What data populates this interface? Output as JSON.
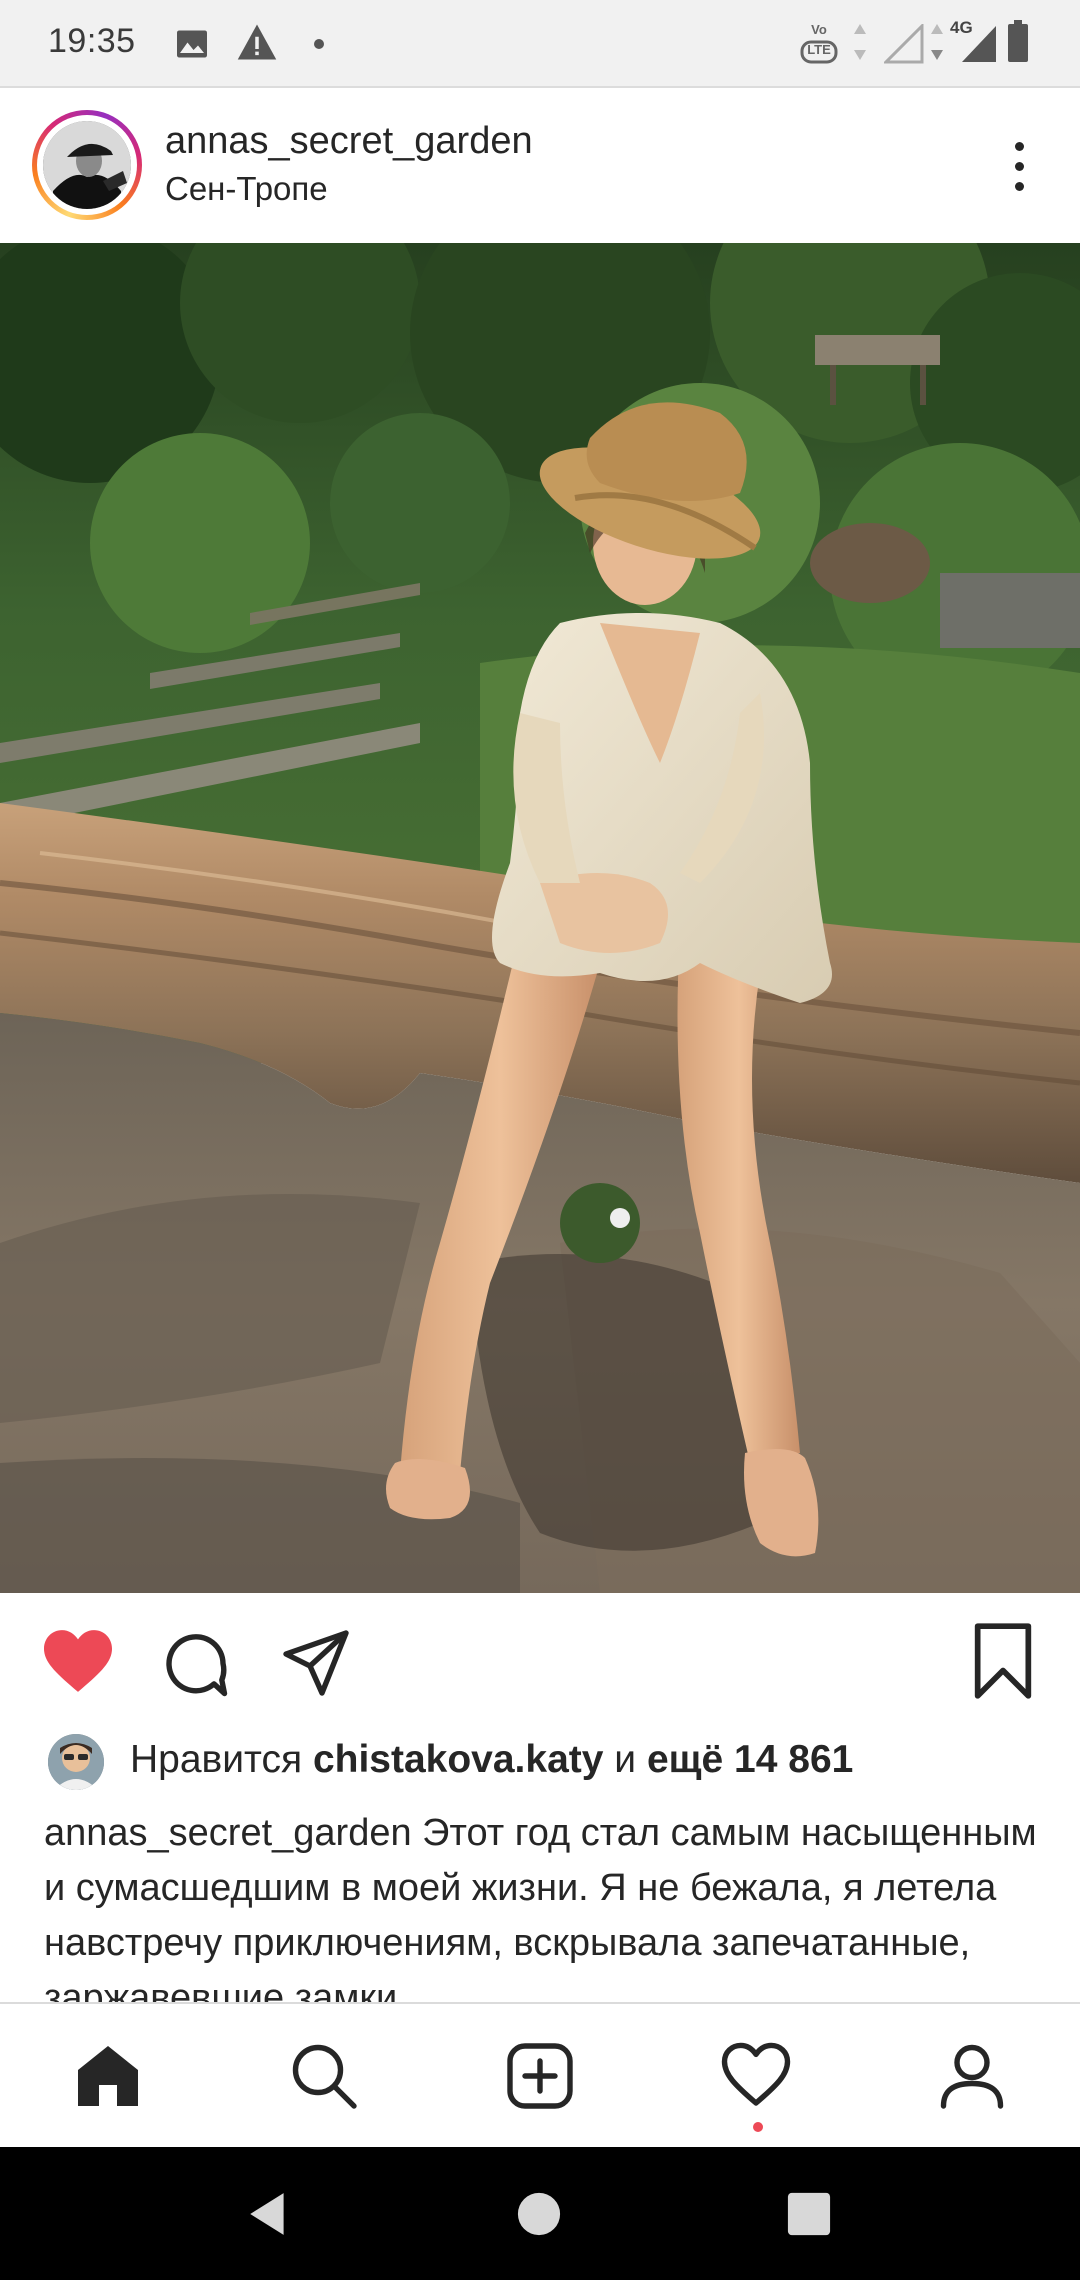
{
  "status_bar": {
    "time": "19:35",
    "icons": [
      "image-icon",
      "warning-icon",
      "notification-dot-icon",
      "volte-icon",
      "wifi-signal-icon",
      "cell-signal-icon",
      "battery-icon"
    ],
    "network_label": "4G",
    "volte_label": "Vo LTE"
  },
  "post": {
    "username": "annas_secret_garden",
    "location": "Сен-Тропе",
    "liked": true,
    "like_color": "#ed4956"
  },
  "likes": {
    "prefix": "Нравится",
    "liker": "chistakova.katy",
    "conjunction": "и",
    "others": "ещё 14 861"
  },
  "caption": {
    "username": "annas_secret_garden",
    "text": "Этот год стал самым насыщенным и сумасшедшим в моей жизни. Я не бежала, я летела навстречу приключениям, вскрывала запечатанные, заржавевшие замки"
  },
  "bottom_nav": {
    "items": [
      "home-icon",
      "search-icon",
      "new-post-icon",
      "activity-heart-icon",
      "profile-icon"
    ],
    "active": "home-icon",
    "notification_dot_color": "#ed4956"
  },
  "system_nav": [
    "back-icon",
    "home-circle-icon",
    "recents-square-icon"
  ]
}
